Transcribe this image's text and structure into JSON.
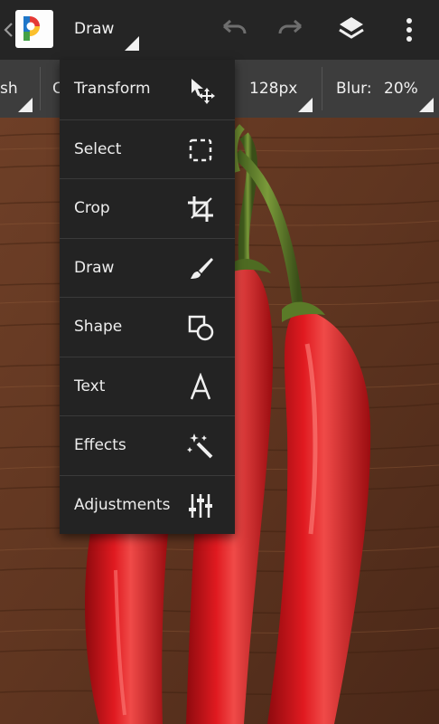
{
  "app_bar": {
    "mode_title": "Draw",
    "icons": [
      "back-caret-icon",
      "app-logo-icon",
      "undo-icon",
      "redo-icon",
      "layers-icon",
      "overflow-menu-icon"
    ]
  },
  "options_bar": {
    "brush_partial": "sh",
    "second_partial": "C",
    "size_value": "128px",
    "blur_label": "Blur:",
    "blur_value": "20%"
  },
  "tool_menu": {
    "items": [
      {
        "label": "Transform",
        "icon": "transform-icon"
      },
      {
        "label": "Select",
        "icon": "select-icon"
      },
      {
        "label": "Crop",
        "icon": "crop-icon"
      },
      {
        "label": "Draw",
        "icon": "brush-icon"
      },
      {
        "label": "Shape",
        "icon": "shape-icon"
      },
      {
        "label": "Text",
        "icon": "text-icon"
      },
      {
        "label": "Effects",
        "icon": "magic-wand-icon"
      },
      {
        "label": "Adjustments",
        "icon": "adjustments-icon"
      }
    ]
  },
  "colors": {
    "app_bar_bg": "#252525",
    "options_bar_bg": "#3d3d3d",
    "menu_bg": "#232323",
    "wood": "#6a3a22",
    "pepper_red": "#d4141a"
  }
}
